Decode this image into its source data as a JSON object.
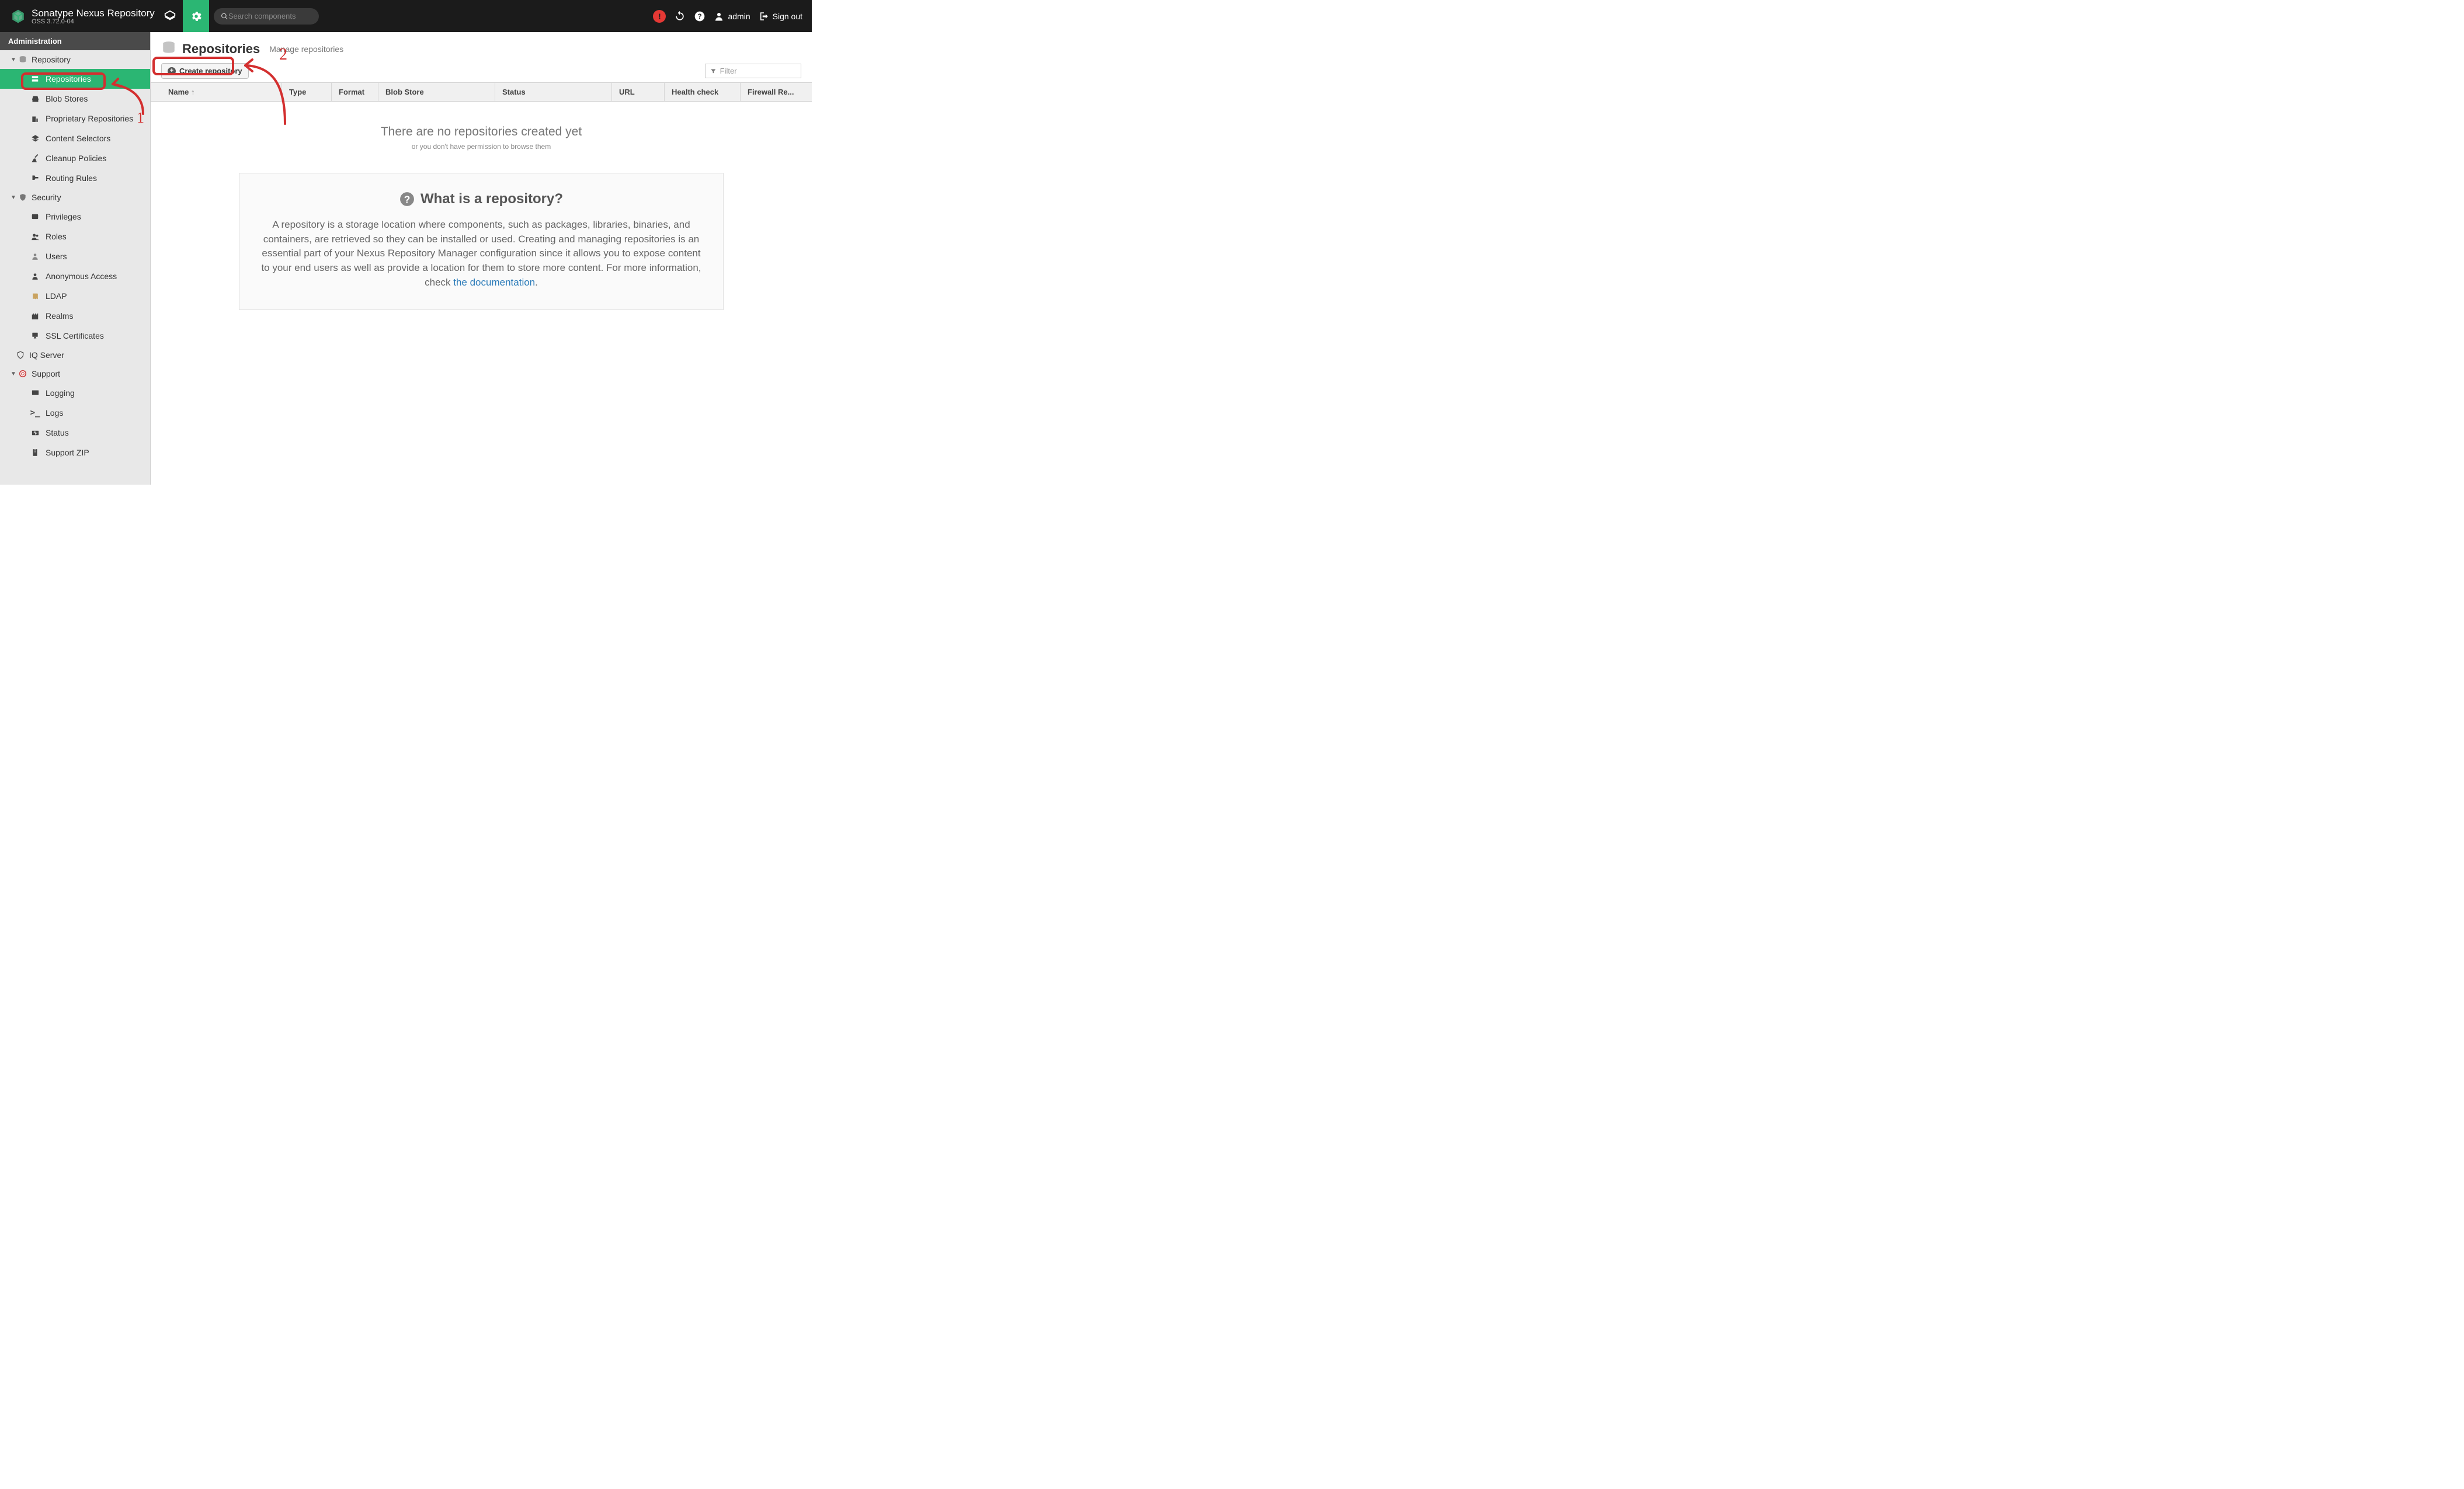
{
  "header": {
    "product_name": "Sonatype Nexus Repository",
    "product_version": "OSS 3.72.0-04",
    "search_placeholder": "Search components",
    "username": "admin",
    "signout": "Sign out"
  },
  "sidebar": {
    "title": "Administration",
    "sections": [
      {
        "label": "Repository",
        "expanded": true,
        "items": [
          {
            "label": "Repositories",
            "icon": "server-icon",
            "active": true
          },
          {
            "label": "Blob Stores",
            "icon": "hdd-icon"
          },
          {
            "label": "Proprietary Repositories",
            "icon": "building-icon"
          },
          {
            "label": "Content Selectors",
            "icon": "layers-icon"
          },
          {
            "label": "Cleanup Policies",
            "icon": "broom-icon"
          },
          {
            "label": "Routing Rules",
            "icon": "route-icon"
          }
        ]
      },
      {
        "label": "Security",
        "expanded": true,
        "items": [
          {
            "label": "Privileges",
            "icon": "id-card-icon"
          },
          {
            "label": "Roles",
            "icon": "users-icon"
          },
          {
            "label": "Users",
            "icon": "user-icon"
          },
          {
            "label": "Anonymous Access",
            "icon": "person-icon"
          },
          {
            "label": "LDAP",
            "icon": "book-icon"
          },
          {
            "label": "Realms",
            "icon": "castle-icon"
          },
          {
            "label": "SSL Certificates",
            "icon": "cert-icon"
          }
        ]
      },
      {
        "label": "IQ Server",
        "expanded": false,
        "leaf": true
      },
      {
        "label": "Support",
        "expanded": true,
        "items": [
          {
            "label": "Logging",
            "icon": "monitor-icon"
          },
          {
            "label": "Logs",
            "icon": "terminal-icon"
          },
          {
            "label": "Status",
            "icon": "heartbeat-icon"
          },
          {
            "label": "Support ZIP",
            "icon": "archive-icon"
          }
        ]
      }
    ]
  },
  "page": {
    "title": "Repositories",
    "subtitle": "Manage repositories",
    "create_btn": "Create repository",
    "filter_placeholder": "Filter",
    "columns": {
      "name": "Name",
      "type": "Type",
      "format": "Format",
      "blob": "Blob Store",
      "status": "Status",
      "url": "URL",
      "health": "Health check",
      "firewall": "Firewall Re..."
    },
    "empty_heading": "There are no repositories created yet",
    "empty_sub": "or you don't have permission to browse them",
    "info": {
      "heading": "What is a repository?",
      "body": "A repository is a storage location where components, such as packages, libraries, binaries, and containers, are retrieved so they can be installed or used. Creating and managing repositories is an essential part of your Nexus Repository Manager configuration since it allows you to expose content to your end users as well as provide a location for them to store more content. For more information, check ",
      "link_text": "the documentation",
      "period": "."
    }
  },
  "annotations": {
    "label1": "1",
    "label2": "2"
  }
}
